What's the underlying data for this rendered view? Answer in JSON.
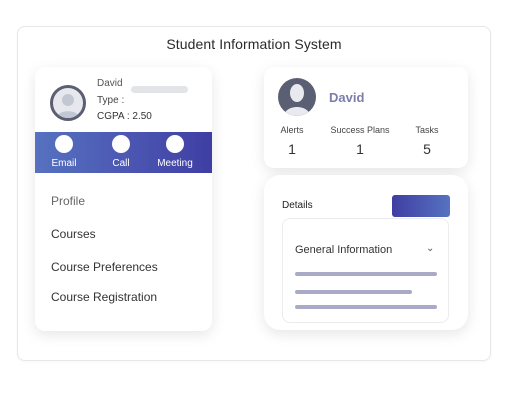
{
  "app": {
    "title": "Student Information System"
  },
  "profile": {
    "name": "David",
    "type_label": "Type :",
    "cgpa_label": "CGPA : 2.50"
  },
  "actions": [
    {
      "label": "Email",
      "icon": "email-icon"
    },
    {
      "label": "Call",
      "icon": "call-icon"
    },
    {
      "label": "Meeting",
      "icon": "meeting-icon"
    }
  ],
  "menu": [
    {
      "label": "Profile"
    },
    {
      "label": "Courses"
    },
    {
      "label": "Course Preferences"
    },
    {
      "label": "Course Registration"
    }
  ],
  "summary": {
    "name": "David",
    "stats": [
      {
        "label": "Alerts",
        "value": "1"
      },
      {
        "label": "Success Plans",
        "value": "1"
      },
      {
        "label": "Tasks",
        "value": "5"
      }
    ]
  },
  "details": {
    "label": "Details",
    "section": "General Information"
  },
  "colors": {
    "accent_start": "#5672c0",
    "accent_end": "#3f3ea3",
    "avatar_dark": "#5b5f73",
    "placeholder_line": "#a9aac7",
    "summary_name": "#7a7ea8"
  }
}
